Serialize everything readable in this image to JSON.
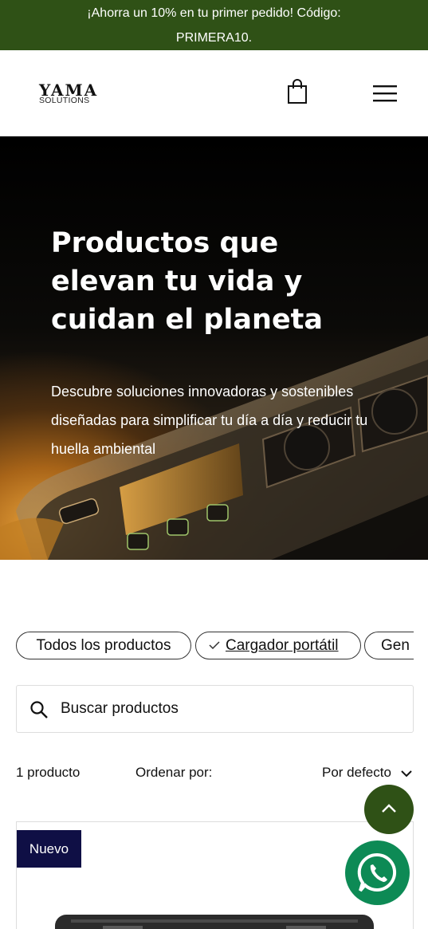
{
  "promo": {
    "line1": "¡Ahorra un 10% en tu primer pedido! Código:",
    "line2": "PRIMERA10."
  },
  "header": {
    "logo_main": "YAMA",
    "logo_sub": "SOLUTIONS",
    "cart_icon": "shopping-bag-icon",
    "menu_icon": "hamburger-menu-icon"
  },
  "hero": {
    "title": "Productos que elevan tu vida y cuidan el planeta",
    "description": "Descubre soluciones innovadoras y sostenibles diseñadas para simplificar tu día a día y reducir tu huella ambiental"
  },
  "filters": {
    "items": [
      {
        "label": "Todos los productos",
        "active": false
      },
      {
        "label": "Cargador portátil",
        "active": true
      },
      {
        "label": "Gen",
        "active": false
      }
    ]
  },
  "search": {
    "placeholder": "Buscar productos",
    "value": ""
  },
  "results": {
    "count": "1 producto",
    "sort_label": "Ordenar por:",
    "sort_value": "Por defecto"
  },
  "product": {
    "badge": "Nuevo"
  },
  "floating": {
    "to_top_icon": "chevron-up-icon",
    "whatsapp_icon": "whatsapp-icon"
  },
  "colors": {
    "brand_green": "#2f5116",
    "badge_navy": "#0f0f45",
    "whatsapp_green": "#0d8a55"
  }
}
